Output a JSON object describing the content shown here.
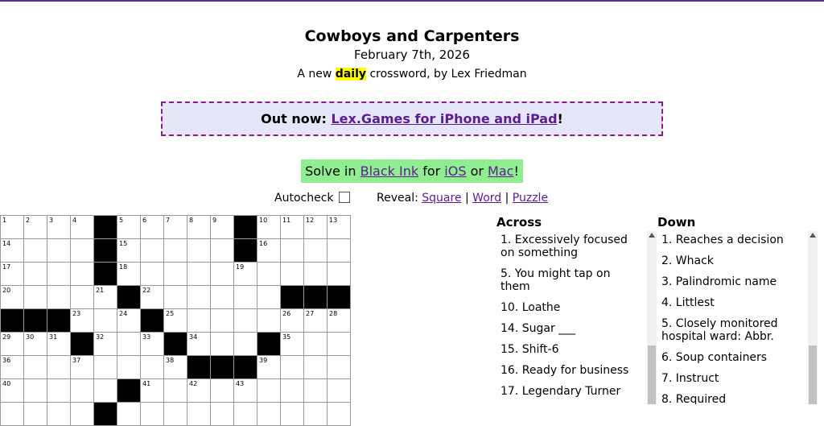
{
  "puzzle": {
    "title": "Cowboys and Carpenters",
    "date": "February 7th, 2026",
    "byline_before": "A new ",
    "byline_highlight": "daily",
    "byline_after": " crossword, by Lex Friedman"
  },
  "promo": {
    "prefix": "Out now: ",
    "link": "Lex.Games for iPhone and iPad",
    "suffix": "!"
  },
  "solve": {
    "prefix": "Solve in ",
    "app": "Black Ink",
    "middle": " for ",
    "ios": "iOS",
    "or": " or ",
    "mac": "Mac",
    "suffix": "!"
  },
  "controls": {
    "autocheck_label": "Autocheck",
    "reveal_label": "Reveal: ",
    "reveal_square": "Square",
    "reveal_word": "Word",
    "reveal_puzzle": "Puzzle",
    "sep": " | "
  },
  "grid": {
    "rows": [
      [
        "1",
        "2",
        "3",
        "4",
        "#",
        "5",
        "6",
        "7",
        "8",
        "9",
        "#",
        "10",
        "11",
        "12",
        "13"
      ],
      [
        "14",
        "",
        "",
        "",
        "#",
        "15",
        "",
        "",
        "",
        "",
        "#",
        "16",
        "",
        "",
        ""
      ],
      [
        "17",
        "",
        "",
        "",
        "#",
        "18",
        "",
        "",
        "",
        "",
        "19",
        "",
        "",
        "",
        ""
      ],
      [
        "20",
        "",
        "",
        "",
        "21",
        "#",
        "22",
        "",
        "",
        "",
        "",
        "",
        "#",
        "#",
        "#"
      ],
      [
        "#",
        "#",
        "#",
        "23",
        "",
        "24",
        "#",
        "25",
        "",
        "",
        "",
        "",
        "26",
        "27",
        "28"
      ],
      [
        "29",
        "30",
        "31",
        "#",
        "32",
        "",
        "33",
        "#",
        "34",
        "",
        "",
        "#",
        "35",
        "",
        ""
      ],
      [
        "36",
        "",
        "",
        "37",
        "",
        "",
        "",
        "38",
        "#",
        "#",
        "#",
        "39",
        "",
        "",
        ""
      ],
      [
        "40",
        "",
        "",
        "",
        "",
        "#",
        "41",
        "",
        "42",
        "",
        "43",
        "",
        "",
        "",
        ""
      ],
      [
        "",
        "",
        "",
        "",
        "#",
        "",
        "",
        "",
        "",
        "",
        "",
        "",
        "",
        "",
        ""
      ]
    ]
  },
  "across": {
    "heading": "Across",
    "clues": [
      "1. Excessively focused on something",
      "5. You might tap on them",
      "10. Loathe",
      "14. Sugar ___",
      "15. Shift-6",
      "16. Ready for business",
      "17. Legendary Turner"
    ]
  },
  "down": {
    "heading": "Down",
    "clues": [
      "1. Reaches a decision",
      "2. Whack",
      "3. Palindromic name",
      "4. Littlest",
      "5. Closely monitored hospital ward: Abbr.",
      "6. Soup containers",
      "7. Instruct",
      "8. Required"
    ]
  }
}
